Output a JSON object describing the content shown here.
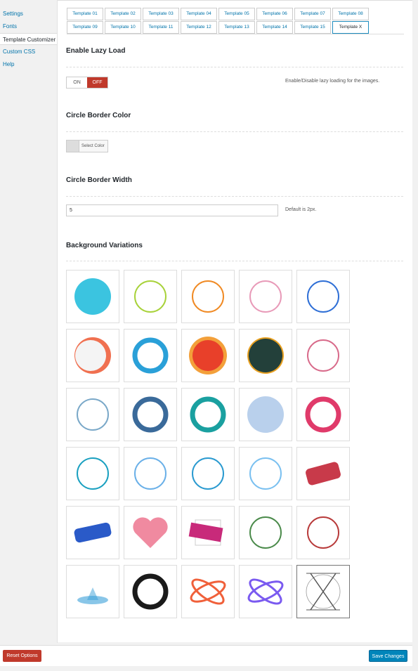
{
  "sidebar": {
    "items": [
      {
        "label": "Settings",
        "active": false
      },
      {
        "label": "Fonts",
        "active": false
      },
      {
        "label": "Template Customizer",
        "active": true
      },
      {
        "label": "Custom CSS",
        "active": false
      },
      {
        "label": "Help",
        "active": false
      }
    ]
  },
  "tabs": {
    "row1": [
      "Template 01",
      "Template 02",
      "Template 03",
      "Template 04",
      "Template 05",
      "Template 06",
      "Template 07",
      "Template 08"
    ],
    "row2": [
      "Template 09",
      "Template 10",
      "Template 11",
      "Template 12",
      "Template 13",
      "Template 14",
      "Template 15",
      "Template X"
    ],
    "active": "Template X"
  },
  "lazy_load": {
    "title": "Enable Lazy Load",
    "on_label": "ON",
    "off_label": "OFF",
    "state": "OFF",
    "help": "Enable/Disable lazy loading for the images."
  },
  "border_color": {
    "title": "Circle Border Color",
    "button_label": "Select Color"
  },
  "border_width": {
    "title": "Circle Border Width",
    "value": "5",
    "help": "Default is 2px."
  },
  "backgrounds": {
    "title": "Background Variations",
    "items": [
      {
        "icon": "solid-cyan-blob-icon",
        "color": "#3bc4e0"
      },
      {
        "icon": "green-yellow-brush-ring-icon",
        "color": "#a8d23a"
      },
      {
        "icon": "orange-brush-ring-icon",
        "color": "#f08a24"
      },
      {
        "icon": "pastel-watercolor-ring-icon",
        "color": "#e89ab8"
      },
      {
        "icon": "blue-brush-ring-icon",
        "color": "#2f6fd6"
      },
      {
        "icon": "white-orange-3d-ring-icon",
        "color": "#f07050"
      },
      {
        "icon": "rainbow-ring-icon",
        "color": "#2aa0d8"
      },
      {
        "icon": "red-orange-blob-circle-icon",
        "color": "#e8402a"
      },
      {
        "icon": "dark-green-gold-circle-icon",
        "color": "#23403a"
      },
      {
        "icon": "thin-multicolor-ring-icon",
        "color": "#d86a8a"
      },
      {
        "icon": "dotted-network-ring-icon",
        "color": "#7aa8c8"
      },
      {
        "icon": "blue-sketch-sphere-icon",
        "color": "#3a6a9a"
      },
      {
        "icon": "teal-green-swirl-ring-icon",
        "color": "#1aa0a0"
      },
      {
        "icon": "blue-scribble-circle-icon",
        "color": "#8ab0e0"
      },
      {
        "icon": "colorful-dots-ring-icon",
        "color": "#e03a6a"
      },
      {
        "icon": "teal-polygon-splash-icon",
        "color": "#1aa0c0"
      },
      {
        "icon": "blue-hud-circle-icon",
        "color": "#6ab0e8"
      },
      {
        "icon": "blue-radial-dots-icon",
        "color": "#2a9ad0"
      },
      {
        "icon": "blue-glow-target-icon",
        "color": "#7ac0f0"
      },
      {
        "icon": "red-brush-stroke-icon",
        "color": "#c83a4a"
      },
      {
        "icon": "blue-brush-stroke-icon",
        "color": "#2a5ac8"
      },
      {
        "icon": "pink-watercolor-heart-icon",
        "color": "#f08aa0"
      },
      {
        "icon": "magenta-brush-square-icon",
        "color": "#c82a7a"
      },
      {
        "icon": "floral-wreath-ring-icon",
        "color": "#4a8a4a"
      },
      {
        "icon": "red-twig-wreath-icon",
        "color": "#b83a3a"
      },
      {
        "icon": "water-splash-icon",
        "color": "#3aa0d8"
      },
      {
        "icon": "black-ink-ring-icon",
        "color": "#1a1a1a"
      },
      {
        "icon": "red-orbit-rings-icon",
        "color": "#f0603a"
      },
      {
        "icon": "purple-orbit-rings-icon",
        "color": "#7a5af0"
      },
      {
        "icon": "x-letter-circle-icon",
        "color": "#555555"
      }
    ]
  },
  "footer": {
    "reset_label": "Reset Options",
    "save_label": "Save Changes"
  }
}
